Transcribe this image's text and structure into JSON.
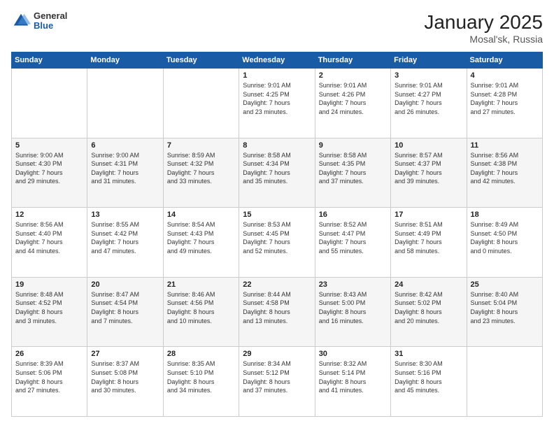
{
  "logo": {
    "general": "General",
    "blue": "Blue"
  },
  "title": {
    "month_year": "January 2025",
    "location": "Mosal'sk, Russia"
  },
  "days_of_week": [
    "Sunday",
    "Monday",
    "Tuesday",
    "Wednesday",
    "Thursday",
    "Friday",
    "Saturday"
  ],
  "weeks": [
    [
      {
        "day": "",
        "info": ""
      },
      {
        "day": "",
        "info": ""
      },
      {
        "day": "",
        "info": ""
      },
      {
        "day": "1",
        "info": "Sunrise: 9:01 AM\nSunset: 4:25 PM\nDaylight: 7 hours\nand 23 minutes."
      },
      {
        "day": "2",
        "info": "Sunrise: 9:01 AM\nSunset: 4:26 PM\nDaylight: 7 hours\nand 24 minutes."
      },
      {
        "day": "3",
        "info": "Sunrise: 9:01 AM\nSunset: 4:27 PM\nDaylight: 7 hours\nand 26 minutes."
      },
      {
        "day": "4",
        "info": "Sunrise: 9:01 AM\nSunset: 4:28 PM\nDaylight: 7 hours\nand 27 minutes."
      }
    ],
    [
      {
        "day": "5",
        "info": "Sunrise: 9:00 AM\nSunset: 4:30 PM\nDaylight: 7 hours\nand 29 minutes."
      },
      {
        "day": "6",
        "info": "Sunrise: 9:00 AM\nSunset: 4:31 PM\nDaylight: 7 hours\nand 31 minutes."
      },
      {
        "day": "7",
        "info": "Sunrise: 8:59 AM\nSunset: 4:32 PM\nDaylight: 7 hours\nand 33 minutes."
      },
      {
        "day": "8",
        "info": "Sunrise: 8:58 AM\nSunset: 4:34 PM\nDaylight: 7 hours\nand 35 minutes."
      },
      {
        "day": "9",
        "info": "Sunrise: 8:58 AM\nSunset: 4:35 PM\nDaylight: 7 hours\nand 37 minutes."
      },
      {
        "day": "10",
        "info": "Sunrise: 8:57 AM\nSunset: 4:37 PM\nDaylight: 7 hours\nand 39 minutes."
      },
      {
        "day": "11",
        "info": "Sunrise: 8:56 AM\nSunset: 4:38 PM\nDaylight: 7 hours\nand 42 minutes."
      }
    ],
    [
      {
        "day": "12",
        "info": "Sunrise: 8:56 AM\nSunset: 4:40 PM\nDaylight: 7 hours\nand 44 minutes."
      },
      {
        "day": "13",
        "info": "Sunrise: 8:55 AM\nSunset: 4:42 PM\nDaylight: 7 hours\nand 47 minutes."
      },
      {
        "day": "14",
        "info": "Sunrise: 8:54 AM\nSunset: 4:43 PM\nDaylight: 7 hours\nand 49 minutes."
      },
      {
        "day": "15",
        "info": "Sunrise: 8:53 AM\nSunset: 4:45 PM\nDaylight: 7 hours\nand 52 minutes."
      },
      {
        "day": "16",
        "info": "Sunrise: 8:52 AM\nSunset: 4:47 PM\nDaylight: 7 hours\nand 55 minutes."
      },
      {
        "day": "17",
        "info": "Sunrise: 8:51 AM\nSunset: 4:49 PM\nDaylight: 7 hours\nand 58 minutes."
      },
      {
        "day": "18",
        "info": "Sunrise: 8:49 AM\nSunset: 4:50 PM\nDaylight: 8 hours\nand 0 minutes."
      }
    ],
    [
      {
        "day": "19",
        "info": "Sunrise: 8:48 AM\nSunset: 4:52 PM\nDaylight: 8 hours\nand 3 minutes."
      },
      {
        "day": "20",
        "info": "Sunrise: 8:47 AM\nSunset: 4:54 PM\nDaylight: 8 hours\nand 7 minutes."
      },
      {
        "day": "21",
        "info": "Sunrise: 8:46 AM\nSunset: 4:56 PM\nDaylight: 8 hours\nand 10 minutes."
      },
      {
        "day": "22",
        "info": "Sunrise: 8:44 AM\nSunset: 4:58 PM\nDaylight: 8 hours\nand 13 minutes."
      },
      {
        "day": "23",
        "info": "Sunrise: 8:43 AM\nSunset: 5:00 PM\nDaylight: 8 hours\nand 16 minutes."
      },
      {
        "day": "24",
        "info": "Sunrise: 8:42 AM\nSunset: 5:02 PM\nDaylight: 8 hours\nand 20 minutes."
      },
      {
        "day": "25",
        "info": "Sunrise: 8:40 AM\nSunset: 5:04 PM\nDaylight: 8 hours\nand 23 minutes."
      }
    ],
    [
      {
        "day": "26",
        "info": "Sunrise: 8:39 AM\nSunset: 5:06 PM\nDaylight: 8 hours\nand 27 minutes."
      },
      {
        "day": "27",
        "info": "Sunrise: 8:37 AM\nSunset: 5:08 PM\nDaylight: 8 hours\nand 30 minutes."
      },
      {
        "day": "28",
        "info": "Sunrise: 8:35 AM\nSunset: 5:10 PM\nDaylight: 8 hours\nand 34 minutes."
      },
      {
        "day": "29",
        "info": "Sunrise: 8:34 AM\nSunset: 5:12 PM\nDaylight: 8 hours\nand 37 minutes."
      },
      {
        "day": "30",
        "info": "Sunrise: 8:32 AM\nSunset: 5:14 PM\nDaylight: 8 hours\nand 41 minutes."
      },
      {
        "day": "31",
        "info": "Sunrise: 8:30 AM\nSunset: 5:16 PM\nDaylight: 8 hours\nand 45 minutes."
      },
      {
        "day": "",
        "info": ""
      }
    ]
  ]
}
